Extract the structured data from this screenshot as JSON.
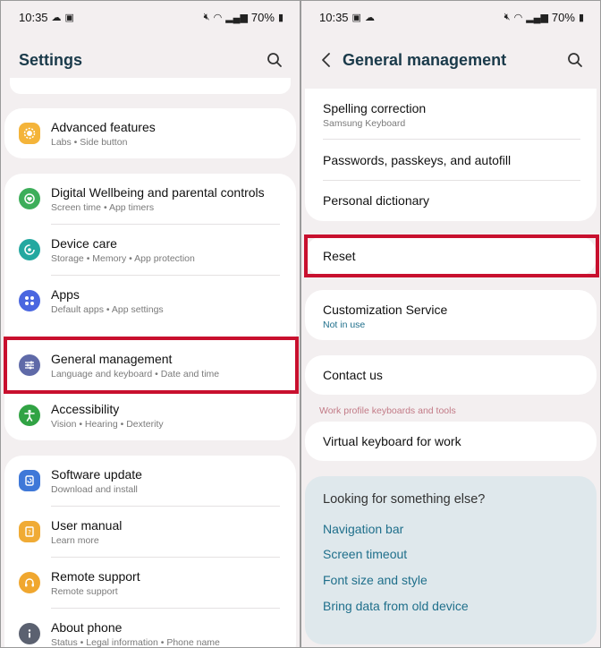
{
  "left": {
    "status": {
      "time": "10:35",
      "battery": "70%"
    },
    "title": "Settings",
    "rows": [
      {
        "title": "Advanced features",
        "sub": "Labs  •  Side button",
        "icon_color": "#f4b43a"
      },
      {
        "title": "Digital Wellbeing and parental controls",
        "sub": "Screen time  •  App timers",
        "icon_color": "#3dae5a"
      },
      {
        "title": "Device care",
        "sub": "Storage  •  Memory  •  App protection",
        "icon_color": "#24a8a0"
      },
      {
        "title": "Apps",
        "sub": "Default apps  •  App settings",
        "icon_color": "#4a66e0"
      },
      {
        "title": "General management",
        "sub": "Language and keyboard  •  Date and time",
        "icon_color": "#5f6aa8"
      },
      {
        "title": "Accessibility",
        "sub": "Vision  •  Hearing  •  Dexterity",
        "icon_color": "#31a344"
      },
      {
        "title": "Software update",
        "sub": "Download and install",
        "icon_color": "#3f78d8"
      },
      {
        "title": "User manual",
        "sub": "Learn more",
        "icon_color": "#f0ab35"
      },
      {
        "title": "Remote support",
        "sub": "Remote support",
        "icon_color": "#f0a72f"
      },
      {
        "title": "About phone",
        "sub": "Status  •  Legal information  •  Phone name",
        "icon_color": "#5b6170"
      }
    ]
  },
  "right": {
    "status": {
      "time": "10:35",
      "battery": "70%"
    },
    "title": "General management",
    "rows": [
      {
        "title": "Spelling correction",
        "sub": "Samsung Keyboard"
      },
      {
        "title": "Passwords, passkeys, and autofill"
      },
      {
        "title": "Personal dictionary"
      },
      {
        "title": "Reset"
      },
      {
        "title": "Customization Service",
        "sub": "Not in use"
      },
      {
        "title": "Contact us"
      },
      {
        "title": "Virtual keyboard for work"
      }
    ],
    "section_label": "Work profile keyboards and tools",
    "suggestions": {
      "title": "Looking for something else?",
      "links": [
        "Navigation bar",
        "Screen timeout",
        "Font size and style",
        "Bring data from old device"
      ]
    }
  },
  "colors": {
    "highlight": "#c8102e",
    "link": "#1f6f8b",
    "accent_sub": "#1f6f8b"
  }
}
